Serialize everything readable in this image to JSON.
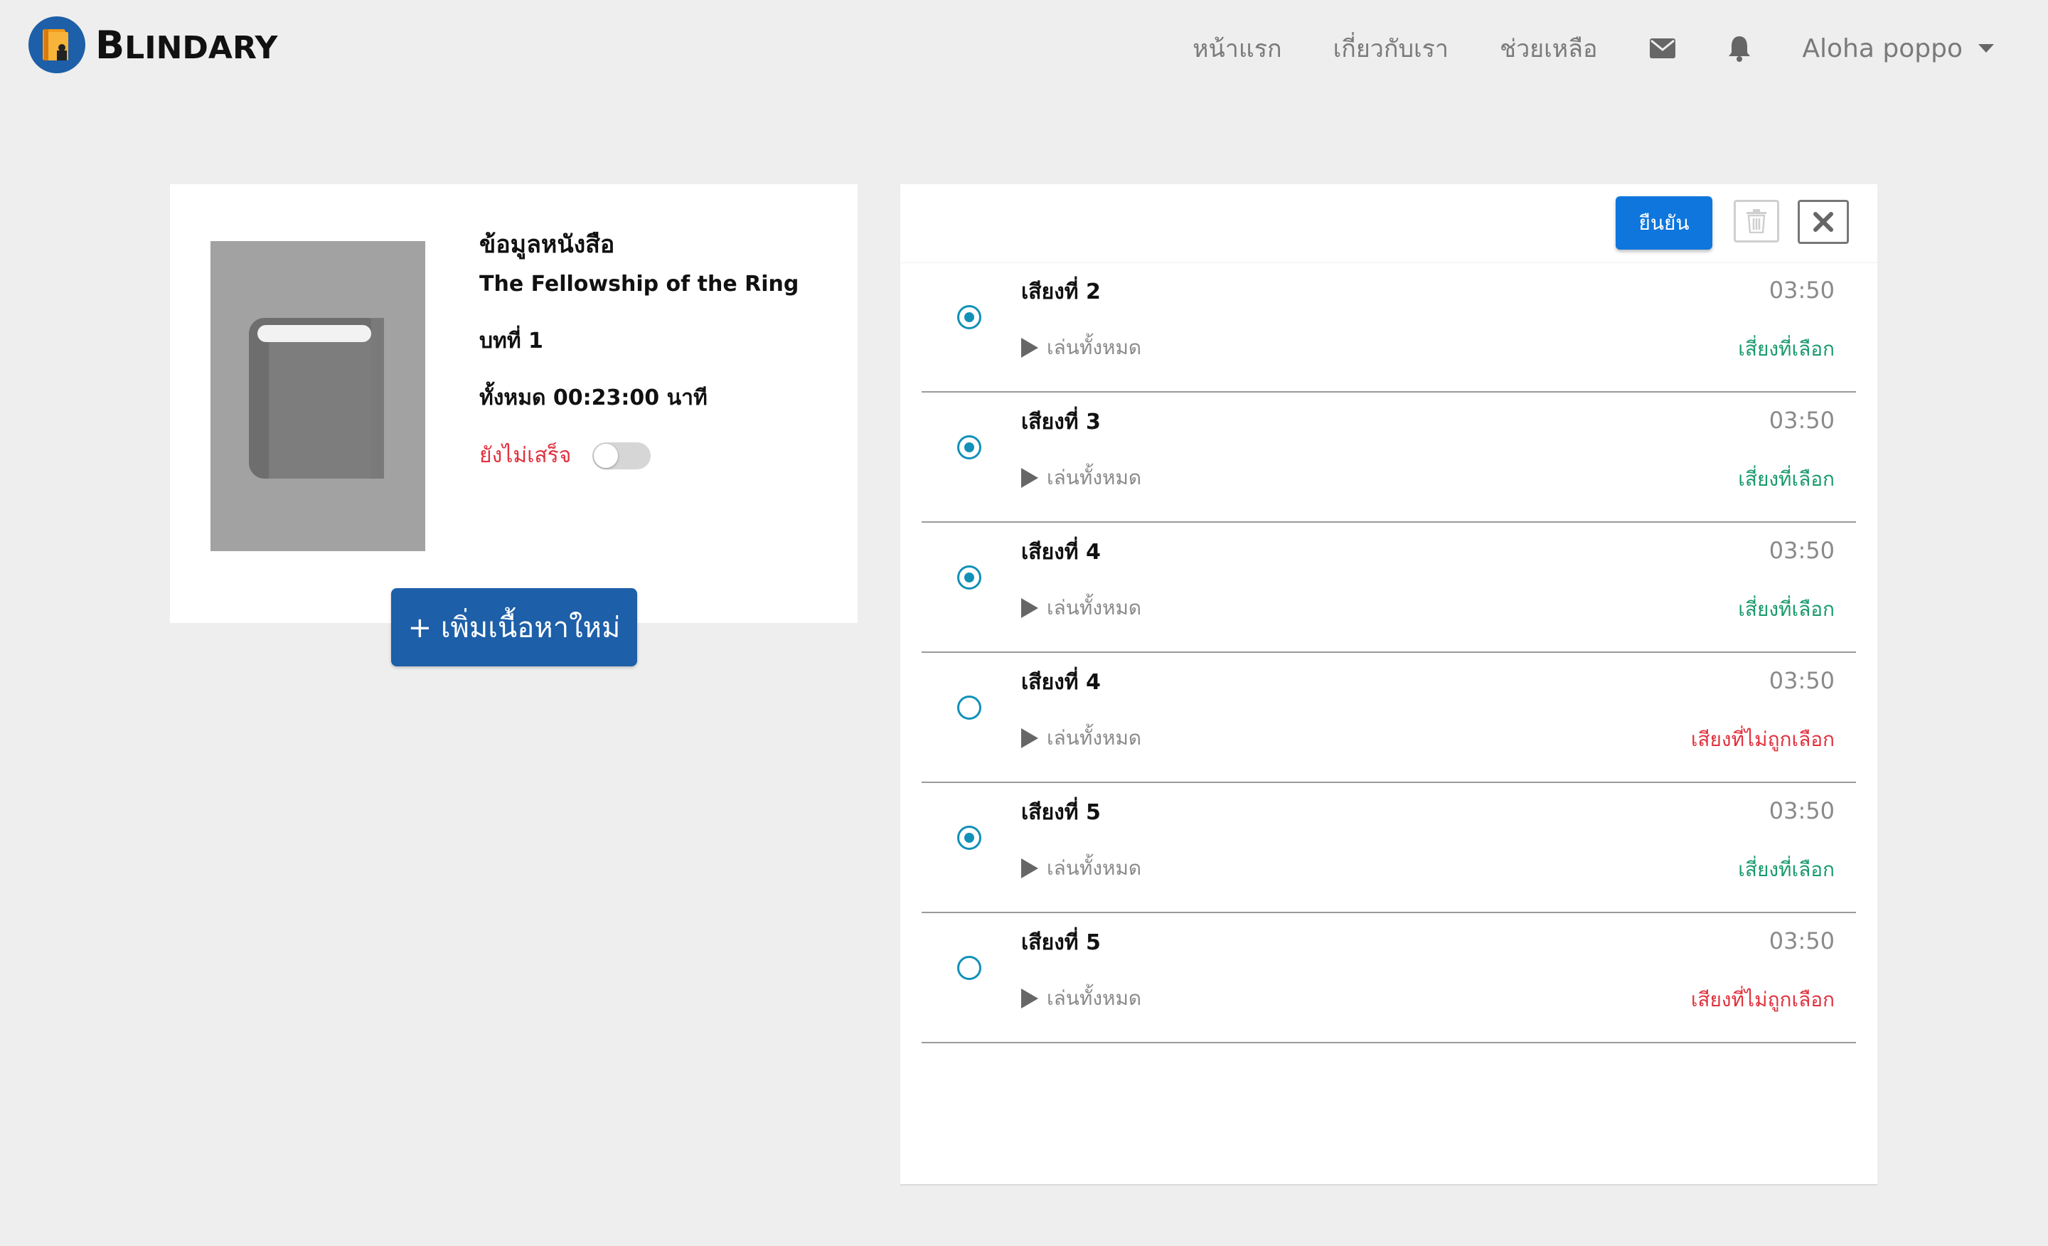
{
  "brand": {
    "name_first": "B",
    "name_rest": "LINDARY",
    "logo_icon": "book-logo-icon"
  },
  "nav": {
    "links": [
      "หน้าแรก",
      "เกี่ยวกับเรา",
      "ช่วยเหลือ"
    ],
    "mail_icon": "envelope-icon",
    "bell_icon": "bell-icon",
    "user_name": "Aloha poppo"
  },
  "book": {
    "heading": "ข้อมูลหนังสือ",
    "title": "The Fellowship of the Ring",
    "chapter": "บทที่ 1",
    "total": "ทั้งหมด 00:23:00 นาที",
    "status": "ยังไม่เสร็จ",
    "status_toggle_on": false,
    "cover_icon": "book-icon"
  },
  "add_button": "+ เพิ่มเนื้อหาใหม่",
  "toolbar": {
    "confirm": "ยืนยัน",
    "trash_icon": "trash-icon",
    "close_icon": "close-icon"
  },
  "audio": {
    "play_label": "เล่นทั้งหมด",
    "items": [
      {
        "name": "เสียงที่ 2",
        "time": "03:50",
        "status": "เสี่ยงที่เลือก",
        "selected": true
      },
      {
        "name": "เสียงที่ 3",
        "time": "03:50",
        "status": "เสี่ยงที่เลือก",
        "selected": true
      },
      {
        "name": "เสียงที่ 4",
        "time": "03:50",
        "status": "เสี่ยงที่เลือก",
        "selected": true
      },
      {
        "name": "เสียงที่ 4",
        "time": "03:50",
        "status": "เสียงที่ไม่ถูกเลือก",
        "selected": false
      },
      {
        "name": "เสียงที่ 5",
        "time": "03:50",
        "status": "เสี่ยงที่เลือก",
        "selected": true
      },
      {
        "name": "เสียงที่ 5",
        "time": "03:50",
        "status": "เสียงที่ไม่ถูกเลือก",
        "selected": false
      }
    ]
  },
  "colors": {
    "brand_blue": "#1d5fa8",
    "confirm_blue": "#0e76dc",
    "radio_teal": "#1290b8",
    "selected_green": "#1a9a6c",
    "unselected_red": "#e0323e",
    "page_bg": "#eeeeee"
  }
}
